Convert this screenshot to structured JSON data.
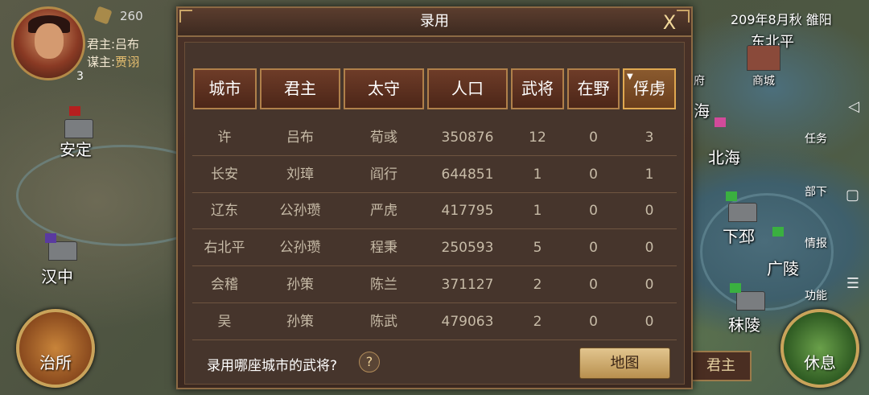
{
  "status": {
    "gold": "260",
    "lord": "君主:吕布",
    "advisor_prefix": "谋主:",
    "advisor_name": "贾诩",
    "badge": "3",
    "date": "209年8月秋 雒阳"
  },
  "map": {
    "places": [
      "安定",
      "汉中",
      "北海",
      "下邳",
      "广陵",
      "秣陵",
      "海",
      "东北平"
    ],
    "buildings": [
      "府",
      "商城"
    ]
  },
  "sidebar": [
    "任务",
    "部下",
    "情报",
    "功能"
  ],
  "system_nav": [
    "◁",
    "▢",
    "☰"
  ],
  "buttons": {
    "govern": "治所",
    "rest": "休息",
    "lord_tab": "君主",
    "map": "地图"
  },
  "dialog": {
    "title": "录用",
    "close": "X",
    "question": "录用哪座城市的武将?",
    "help": "?"
  },
  "table": {
    "headers": [
      "城市",
      "君主",
      "太守",
      "人口",
      "武将",
      "在野",
      "俘虏"
    ],
    "sort_indicator": "▼",
    "rows": [
      [
        "许",
        "吕布",
        "荀彧",
        "350876",
        "12",
        "0",
        "3"
      ],
      [
        "长安",
        "刘璋",
        "阎行",
        "644851",
        "1",
        "0",
        "1"
      ],
      [
        "辽东",
        "公孙瓒",
        "严虎",
        "417795",
        "1",
        "0",
        "0"
      ],
      [
        "右北平",
        "公孙瓒",
        "程秉",
        "250593",
        "5",
        "0",
        "0"
      ],
      [
        "会稽",
        "孙策",
        "陈兰",
        "371127",
        "2",
        "0",
        "0"
      ],
      [
        "吴",
        "孙策",
        "陈武",
        "479063",
        "2",
        "0",
        "0"
      ]
    ]
  }
}
